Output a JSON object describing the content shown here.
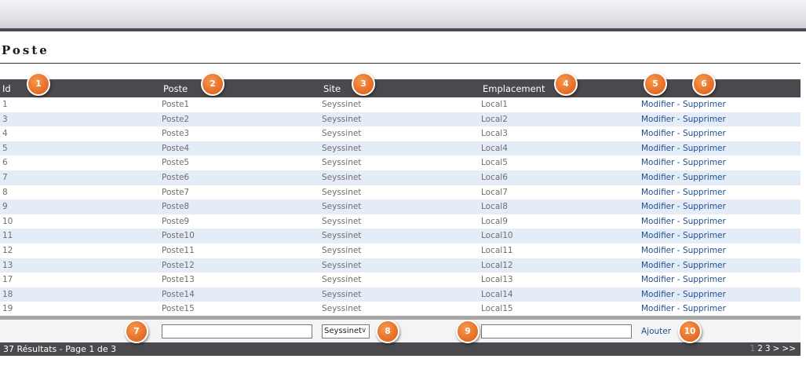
{
  "page": {
    "title": "Poste"
  },
  "table": {
    "headers": {
      "id": "Id",
      "poste": "Poste",
      "site": "Site",
      "emplacement": "Emplacement"
    },
    "rows": [
      {
        "id": "1",
        "poste": "Poste1",
        "site": "Seyssinet",
        "emplacement": "Local1"
      },
      {
        "id": "3",
        "poste": "Poste2",
        "site": "Seyssinet",
        "emplacement": "Local2"
      },
      {
        "id": "4",
        "poste": "Poste3",
        "site": "Seyssinet",
        "emplacement": "Local3"
      },
      {
        "id": "5",
        "poste": "Poste4",
        "site": "Seyssinet",
        "emplacement": "Local4"
      },
      {
        "id": "6",
        "poste": "Poste5",
        "site": "Seyssinet",
        "emplacement": "Local5"
      },
      {
        "id": "7",
        "poste": "Poste6",
        "site": "Seyssinet",
        "emplacement": "Local6"
      },
      {
        "id": "8",
        "poste": "Poste7",
        "site": "Seyssinet",
        "emplacement": "Local7"
      },
      {
        "id": "9",
        "poste": "Poste8",
        "site": "Seyssinet",
        "emplacement": "Local8"
      },
      {
        "id": "10",
        "poste": "Poste9",
        "site": "Seyssinet",
        "emplacement": "Local9"
      },
      {
        "id": "11",
        "poste": "Poste10",
        "site": "Seyssinet",
        "emplacement": "Local10"
      },
      {
        "id": "12",
        "poste": "Poste11",
        "site": "Seyssinet",
        "emplacement": "Local11"
      },
      {
        "id": "13",
        "poste": "Poste12",
        "site": "Seyssinet",
        "emplacement": "Local12"
      },
      {
        "id": "17",
        "poste": "Poste13",
        "site": "Seyssinet",
        "emplacement": "Local13"
      },
      {
        "id": "18",
        "poste": "Poste14",
        "site": "Seyssinet",
        "emplacement": "Local14"
      },
      {
        "id": "19",
        "poste": "Poste15",
        "site": "Seyssinet",
        "emplacement": "Local15"
      }
    ],
    "actions": {
      "modify": "Modifier",
      "separator": " - ",
      "delete": "Supprimer"
    }
  },
  "filters": {
    "poste_value": "",
    "site_selected": "Seyssinet",
    "emplacement_value": "",
    "add_label": "Ajouter"
  },
  "footer": {
    "results": "37 Résultats - Page 1 de 3",
    "pages": [
      "1",
      "2",
      "3",
      ">",
      ">>"
    ],
    "current_page": "1"
  },
  "badges": [
    "1",
    "2",
    "3",
    "4",
    "5",
    "6",
    "7",
    "8",
    "9",
    "10"
  ],
  "colors": {
    "header_bg": "#4a4a4e",
    "row_alt": "#e4ecf8",
    "link": "#1f4f8f",
    "badge": "#e7702a"
  }
}
